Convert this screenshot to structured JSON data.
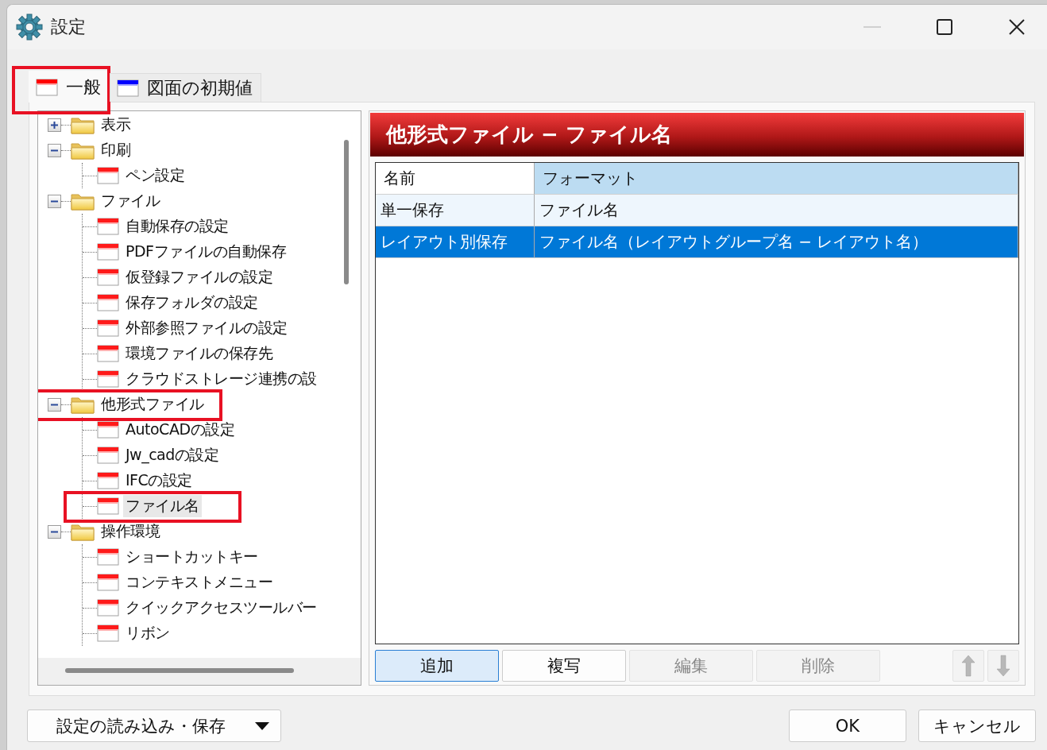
{
  "window": {
    "title": "設定",
    "controls": [
      {
        "kind": "minimize",
        "disabled": true
      },
      {
        "kind": "maximize",
        "disabled": false
      },
      {
        "kind": "close",
        "disabled": false
      }
    ]
  },
  "tabs": [
    {
      "label": "一般",
      "selected": true,
      "highlighted": true,
      "color": "#ff0000"
    },
    {
      "label": "図面の初期値",
      "selected": false,
      "highlighted": false,
      "color": "#0000ff"
    }
  ],
  "tree": {
    "items": [
      {
        "label": "表示",
        "kind": "folder",
        "expanded": false,
        "selected": false,
        "highlighted": false
      },
      {
        "label": "印刷",
        "kind": "folder",
        "expanded": true,
        "selected": false,
        "highlighted": false,
        "children": [
          {
            "label": "ペン設定",
            "kind": "page",
            "selected": false,
            "highlighted": false
          }
        ]
      },
      {
        "label": "ファイル",
        "kind": "folder",
        "expanded": true,
        "selected": false,
        "highlighted": false,
        "children": [
          {
            "label": "自動保存の設定",
            "kind": "page",
            "selected": false,
            "highlighted": false
          },
          {
            "label": "PDFファイルの自動保存",
            "kind": "page",
            "selected": false,
            "highlighted": false
          },
          {
            "label": "仮登録ファイルの設定",
            "kind": "page",
            "selected": false,
            "highlighted": false
          },
          {
            "label": "保存フォルダの設定",
            "kind": "page",
            "selected": false,
            "highlighted": false
          },
          {
            "label": "外部参照ファイルの設定",
            "kind": "page",
            "selected": false,
            "highlighted": false
          },
          {
            "label": "環境ファイルの保存先",
            "kind": "page",
            "selected": false,
            "highlighted": false
          },
          {
            "label": "クラウドストレージ連携の設",
            "kind": "page",
            "selected": false,
            "highlighted": false
          }
        ]
      },
      {
        "label": "他形式ファイル",
        "kind": "folder",
        "expanded": true,
        "selected": false,
        "highlighted": true,
        "children": [
          {
            "label": "AutoCADの設定",
            "kind": "page",
            "selected": false,
            "highlighted": false
          },
          {
            "label": "Jw_cadの設定",
            "kind": "page",
            "selected": false,
            "highlighted": false
          },
          {
            "label": "IFCの設定",
            "kind": "page",
            "selected": false,
            "highlighted": false
          },
          {
            "label": "ファイル名",
            "kind": "page",
            "selected": true,
            "highlighted": true
          }
        ]
      },
      {
        "label": "操作環境",
        "kind": "folder",
        "expanded": true,
        "selected": false,
        "highlighted": false,
        "children": [
          {
            "label": "ショートカットキー",
            "kind": "page",
            "selected": false,
            "highlighted": false
          },
          {
            "label": "コンテキストメニュー",
            "kind": "page",
            "selected": false,
            "highlighted": false
          },
          {
            "label": "クイックアクセスツールバー",
            "kind": "page",
            "selected": false,
            "highlighted": false
          },
          {
            "label": "リボン",
            "kind": "page",
            "selected": false,
            "highlighted": false
          }
        ]
      }
    ]
  },
  "panel": {
    "title": "他形式ファイル − ファイル名",
    "table": {
      "columns": [
        {
          "label": "名前",
          "sorted": false
        },
        {
          "label": "フォーマット",
          "sorted": true
        }
      ],
      "rows": [
        {
          "cells": [
            "単一保存",
            "ファイル名"
          ],
          "selected": false
        },
        {
          "cells": [
            "レイアウト別保存",
            "ファイル名（レイアウトグループ名 − レイアウト名）"
          ],
          "selected": true
        }
      ]
    },
    "buttons": [
      {
        "label": "追加",
        "disabled": false,
        "default": true
      },
      {
        "label": "複写",
        "disabled": false,
        "default": false
      },
      {
        "label": "編集",
        "disabled": true,
        "default": false
      },
      {
        "label": "削除",
        "disabled": true,
        "default": false
      }
    ],
    "arrows": [
      {
        "kind": "up",
        "disabled": true
      },
      {
        "kind": "down",
        "disabled": true
      }
    ]
  },
  "footer": {
    "menu_button": "設定の読み込み・保存",
    "buttons": [
      "OK",
      "キャンセル"
    ]
  }
}
